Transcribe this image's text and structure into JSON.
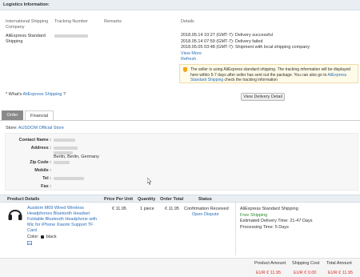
{
  "logistics": {
    "title": "Logistics Information:",
    "columns": {
      "company": [
        "International Shipping",
        "Company"
      ],
      "tracking": "Tracking Number",
      "remarks": "Remarks",
      "details": "Details"
    },
    "company_lines": [
      "AliExpress Standard",
      "Shipping"
    ],
    "events": [
      "2018.05.14 10:27 (GMT-7): Delivery successful",
      "2018.05.14 07:59 (GMT-7): Delivery failed",
      "2018.05.05 03:48 (GMT-7): Shipment with local shipping company"
    ],
    "view_more": "View More",
    "refresh": "Refresh",
    "notice_prefix": "The seller is using AliExpress standard shipping. The tracking information will be displayed here within 5-7 days after seller has sent out the package. You can also go to ",
    "notice_link": "AliExpress Standard Shipping",
    "notice_suffix": " check the tracking information",
    "whats_prefix": "* What's ",
    "whats_link": "AliExpress Shipping",
    "whats_suffix": " ?",
    "view_delivery_detail": "View Delivery Detail"
  },
  "tabs": [
    "Order",
    "Financial"
  ],
  "store": {
    "label": "Store: ",
    "name": "AUSDOM Official Store"
  },
  "address": {
    "labels": {
      "contact": "Contact Name :",
      "address": "Address :",
      "zip": "Zip Code :",
      "mobile": "Mobile :",
      "tel": "Tel :",
      "fax": "Fax :"
    },
    "city_line": "Berlin, Berlin, Germany"
  },
  "products": {
    "headers": [
      "Product Details",
      "Price Per Unit",
      "Quantity",
      "Order Total",
      "Status"
    ],
    "title_lines": [
      "Ausdom M09 Wired Wireless",
      "Headphones Bluetooth Headset",
      "Foldable Bluetooth Headphone with",
      "Mic for iPhone Xiaomi Support TF",
      "Card"
    ],
    "color_label": "Color:",
    "color_value": "black",
    "price": "€ 11.95",
    "quantity": "1 piece",
    "order_total": "€ 11.95",
    "status": "Confirmation Received",
    "open_dispute": "Open Dispute",
    "shipping_method": "AliExpress Standard Shipping",
    "free_shipping": "Free Shipping",
    "delivery_time": "Estimated Delivery Time: 21-47 Days",
    "processing_time": "Processing Time: 5 Days"
  },
  "totals": {
    "headers": [
      "Product Amount",
      "Shipping Cost",
      "Total Amount"
    ],
    "values": [
      "EUR € 11.95",
      "EUR € 0.00",
      "EUR € 11.95"
    ]
  }
}
